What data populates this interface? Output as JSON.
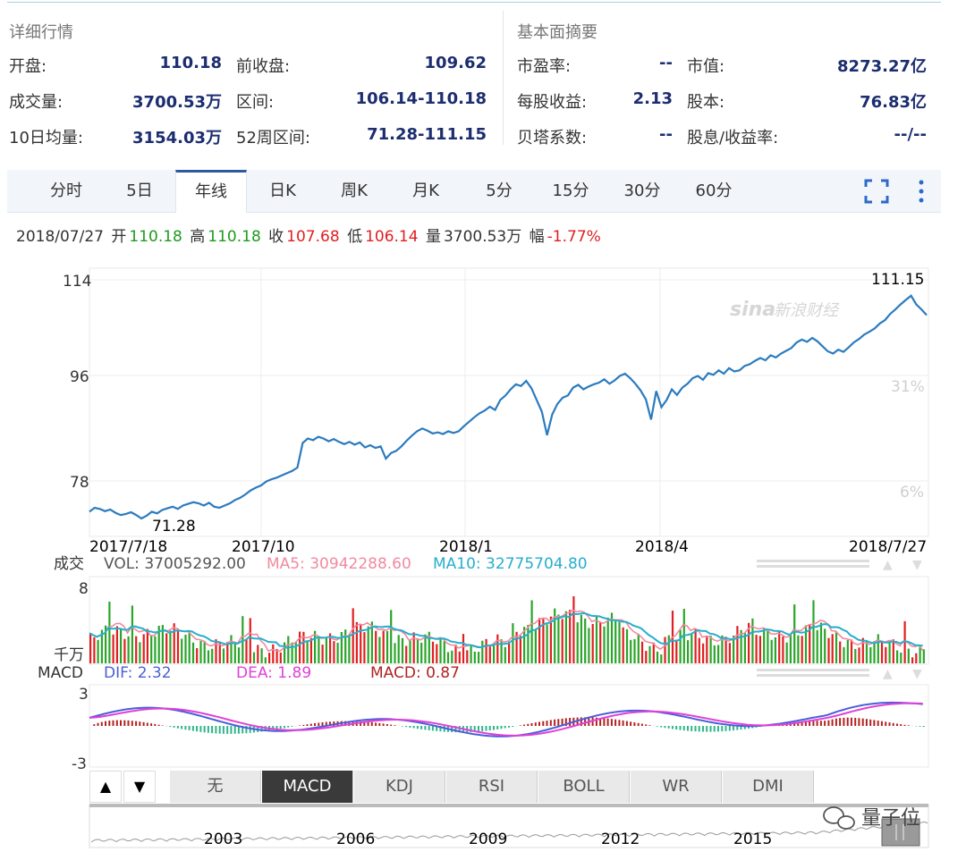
{
  "summary_left": {
    "title": "详细行情",
    "rows": [
      {
        "label1": "开盘:",
        "value1": "110.18",
        "label2": "前收盘:",
        "value2": "109.62"
      },
      {
        "label1": "成交量:",
        "value1": "3700.53万",
        "label2": "区间:",
        "value2": "106.14-110.18"
      },
      {
        "label1": "10日均量:",
        "value1": "3154.03万",
        "label2": "52周区间:",
        "value2": "71.28-111.15"
      }
    ]
  },
  "summary_right": {
    "title": "基本面摘要",
    "rows": [
      {
        "label1": "市盈率:",
        "value1": "--",
        "label2": "市值:",
        "value2": "8273.27亿"
      },
      {
        "label1": "每股收益:",
        "value1": "2.13",
        "label2": "股本:",
        "value2": "76.83亿"
      },
      {
        "label1": "贝塔系数:",
        "value1": "--",
        "label2": "股息/收益率:",
        "value2": "--/--"
      }
    ]
  },
  "tabs": [
    "分时",
    "5日",
    "年线",
    "日K",
    "周K",
    "月K",
    "5分",
    "15分",
    "30分",
    "60分"
  ],
  "active_tab": "年线",
  "icons": {
    "fullscreen": "fullscreen-icon",
    "more": "more-vertical-icon",
    "watermark": "sina-finance-logo",
    "wechat": "wechat-icon"
  },
  "quote": {
    "date": "2018/07/27",
    "open_label": "开",
    "open": "110.18",
    "high_label": "高",
    "high": "110.18",
    "close_label": "收",
    "close": "107.68",
    "low_label": "低",
    "low": "106.14",
    "vol_label": "量",
    "vol": "3700.53万",
    "chg_label": "幅",
    "chg": "-1.77%"
  },
  "watermark_text": "新浪财经",
  "vol_stats": {
    "label": "成交",
    "vol": "VOL: 37005292.00",
    "ma5": "MA5: 30942288.60",
    "ma10": "MA10: 32775704.80"
  },
  "macd_stats": {
    "label": "MACD",
    "dif": "DIF: 2.32",
    "dea": "DEA: 1.89",
    "macd": "MACD: 0.87"
  },
  "indicator_arrows": {
    "up": "▲",
    "down": "▼"
  },
  "indicator_buttons": [
    "无",
    "MACD",
    "KDJ",
    "RSI",
    "BOLL",
    "WR",
    "DMI"
  ],
  "active_indicator": "MACD",
  "brand": "量子位",
  "colors": {
    "price_line": "#2b7bbf",
    "up": "#e02020",
    "down": "#2aa52a",
    "ma5": "#f08aa0",
    "ma10": "#27aecb",
    "dif": "#4a5fd8",
    "dea": "#e040d8",
    "macd_pos": "#b22222",
    "macd_neg": "#2fb58a",
    "value_blue": "#1c2d70"
  },
  "chart_data": [
    {
      "type": "line",
      "title": "",
      "ylabels": [
        "114",
        "96",
        "78"
      ],
      "ylim": [
        71,
        115
      ],
      "right_labels": [
        "31%",
        "6%"
      ],
      "x_labels": [
        "2017/7/18",
        "2017/10",
        "2018/1",
        "2018/4",
        "2018/7/27"
      ],
      "annotations": {
        "high": "111.15",
        "low": "71.28"
      },
      "series": [
        {
          "values": [
            72.5,
            73.2,
            73.0,
            72.6,
            72.9,
            72.3,
            71.9,
            72.1,
            72.4,
            71.9,
            71.28,
            71.8,
            72.5,
            72.2,
            72.8,
            73.1,
            73.4,
            73.0,
            73.6,
            73.9,
            74.2,
            74.0,
            73.6,
            74.1,
            73.4,
            73.2,
            73.6,
            74.0,
            74.6,
            75.0,
            75.6,
            76.3,
            76.8,
            77.2,
            77.9,
            78.3,
            78.6,
            79.0,
            79.4,
            79.8,
            80.4,
            84.8,
            85.6,
            85.3,
            85.9,
            85.6,
            85.1,
            85.5,
            85.0,
            84.6,
            85.0,
            84.5,
            84.9,
            84.0,
            84.4,
            83.9,
            84.2,
            82.0,
            83.0,
            83.4,
            84.2,
            85.2,
            86.1,
            86.9,
            87.4,
            87.0,
            86.5,
            86.7,
            86.4,
            86.9,
            86.6,
            86.9,
            87.8,
            88.6,
            89.4,
            90.1,
            90.6,
            91.3,
            90.7,
            92.5,
            93.3,
            94.4,
            95.3,
            95.0,
            95.9,
            94.6,
            92.5,
            90.4,
            86.2,
            89.9,
            91.8,
            92.9,
            93.3,
            94.7,
            95.2,
            94.4,
            94.9,
            95.3,
            95.6,
            96.2,
            95.4,
            96.0,
            96.8,
            97.2,
            96.4,
            95.4,
            94.2,
            92.6,
            89.0,
            94.1,
            91.2,
            92.5,
            94.4,
            93.4,
            94.7,
            95.4,
            96.4,
            96.8,
            96.1,
            97.3,
            97.0,
            97.8,
            97.2,
            98.2,
            97.6,
            97.8,
            98.6,
            98.9,
            99.5,
            100.0,
            99.6,
            100.5,
            100.1,
            100.8,
            101.3,
            101.8,
            102.8,
            103.3,
            102.9,
            103.6,
            103.0,
            102.1,
            101.2,
            100.8,
            101.5,
            101.1,
            101.9,
            102.8,
            103.4,
            104.2,
            104.7,
            105.3,
            106.2,
            106.8,
            107.9,
            108.7,
            109.6,
            110.4,
            111.15,
            109.6,
            108.7,
            107.68
          ]
        }
      ]
    },
    {
      "type": "bar",
      "title": "成交",
      "ylabels": [
        "8",
        "千万"
      ],
      "series": [
        {
          "name": "VOL",
          "values": [
            3.7
          ]
        },
        {
          "name": "MA5",
          "values": [
            3.09
          ]
        },
        {
          "name": "MA10",
          "values": [
            3.28
          ]
        }
      ]
    },
    {
      "type": "line",
      "title": "MACD",
      "ylabels": [
        "3",
        "-3"
      ],
      "series": [
        {
          "name": "DIF",
          "values": [
            2.32
          ]
        },
        {
          "name": "DEA",
          "values": [
            1.89
          ]
        },
        {
          "name": "MACD",
          "values": [
            0.87
          ]
        }
      ]
    }
  ],
  "navigator": {
    "years": [
      "2003",
      "2006",
      "2009",
      "2012",
      "2015"
    ]
  }
}
